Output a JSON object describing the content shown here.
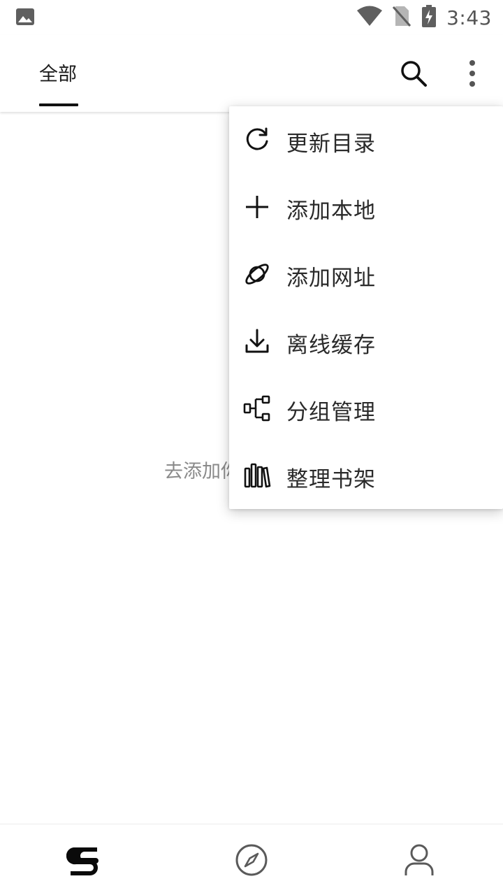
{
  "status_bar": {
    "time": "3:43",
    "icons": [
      "image-notification-icon",
      "wifi-icon",
      "no-sim-icon",
      "battery-charging-icon"
    ]
  },
  "app_bar": {
    "tab_label": "全部",
    "search_icon": "search-icon",
    "more_icon": "more-vert-icon"
  },
  "empty_state": {
    "hint": "去添加你"
  },
  "menu": {
    "items": [
      {
        "label": "更新目录",
        "icon": "refresh-icon"
      },
      {
        "label": "添加本地",
        "icon": "plus-icon"
      },
      {
        "label": "添加网址",
        "icon": "planet-icon"
      },
      {
        "label": "离线缓存",
        "icon": "download-icon"
      },
      {
        "label": "分组管理",
        "icon": "group-manage-icon"
      },
      {
        "label": "整理书架",
        "icon": "books-icon"
      }
    ]
  },
  "bottom_nav": {
    "items": [
      {
        "icon": "bookshelf-icon",
        "active": true
      },
      {
        "icon": "compass-icon",
        "active": false
      },
      {
        "icon": "person-icon",
        "active": false
      }
    ]
  },
  "colors": {
    "background": "#ffffff",
    "text_primary": "#222222",
    "text_hint": "#8a8a8a",
    "indicator": "#111111"
  }
}
